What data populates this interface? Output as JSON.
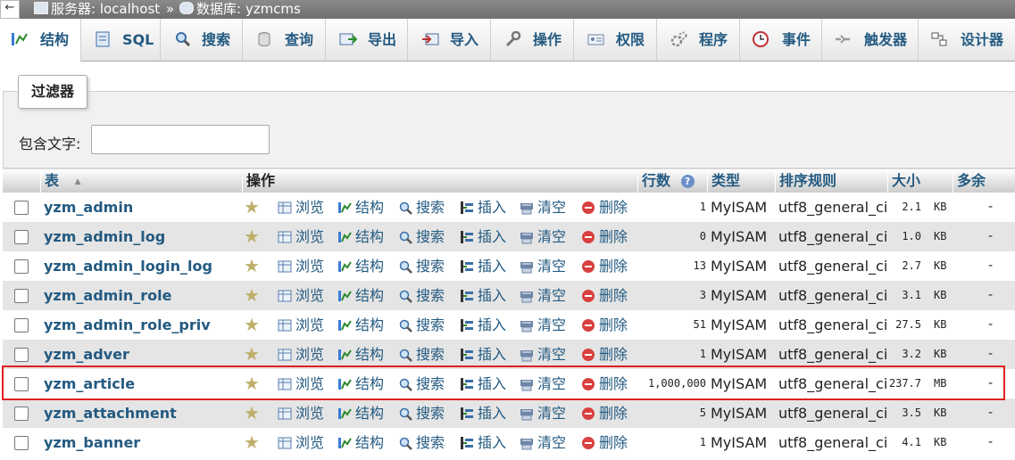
{
  "breadcrumb": {
    "back_glyph": "←",
    "server": "服务器: localhost",
    "sep": "»",
    "database": "数据库: yzmcms"
  },
  "tabs": [
    {
      "label": "结构",
      "icon": "structure-icon",
      "active": true
    },
    {
      "label": "SQL",
      "icon": "sql-icon"
    },
    {
      "label": "搜索",
      "icon": "search-icon"
    },
    {
      "label": "查询",
      "icon": "query-icon"
    },
    {
      "label": "导出",
      "icon": "export-icon"
    },
    {
      "label": "导入",
      "icon": "import-icon"
    },
    {
      "label": "操作",
      "icon": "wrench-icon"
    },
    {
      "label": "权限",
      "icon": "privileges-icon"
    },
    {
      "label": "程序",
      "icon": "routines-icon"
    },
    {
      "label": "事件",
      "icon": "events-icon"
    },
    {
      "label": "触发器",
      "icon": "triggers-icon"
    },
    {
      "label": "设计器",
      "icon": "designer-icon"
    }
  ],
  "filter": {
    "legend": "过滤器",
    "label": "包含文字:",
    "value": ""
  },
  "columns": {
    "table": "表",
    "sort_glyph": "▲",
    "action": "操作",
    "rows": "行数",
    "type": "类型",
    "collation": "排序规则",
    "size": "大小",
    "overhead": "多余"
  },
  "actions": [
    "浏览",
    "结构",
    "搜索",
    "插入",
    "清空",
    "删除"
  ],
  "rows": [
    {
      "name": "yzm_admin",
      "rows": "1",
      "type": "MyISAM",
      "collation": "utf8_general_ci",
      "size": "2.1",
      "unit": "KB",
      "overhead": "-"
    },
    {
      "name": "yzm_admin_log",
      "rows": "0",
      "type": "MyISAM",
      "collation": "utf8_general_ci",
      "size": "1.0",
      "unit": "KB",
      "overhead": "-"
    },
    {
      "name": "yzm_admin_login_log",
      "rows": "13",
      "type": "MyISAM",
      "collation": "utf8_general_ci",
      "size": "2.7",
      "unit": "KB",
      "overhead": "-"
    },
    {
      "name": "yzm_admin_role",
      "rows": "3",
      "type": "MyISAM",
      "collation": "utf8_general_ci",
      "size": "3.1",
      "unit": "KB",
      "overhead": "-"
    },
    {
      "name": "yzm_admin_role_priv",
      "rows": "51",
      "type": "MyISAM",
      "collation": "utf8_general_ci",
      "size": "27.5",
      "unit": "KB",
      "overhead": "-"
    },
    {
      "name": "yzm_adver",
      "rows": "1",
      "type": "MyISAM",
      "collation": "utf8_general_ci",
      "size": "3.2",
      "unit": "KB",
      "overhead": "-"
    },
    {
      "name": "yzm_article",
      "rows": "1,000,000",
      "type": "MyISAM",
      "collation": "utf8_general_ci",
      "size": "237.7",
      "unit": "MB",
      "overhead": "-"
    },
    {
      "name": "yzm_attachment",
      "rows": "5",
      "type": "MyISAM",
      "collation": "utf8_general_ci",
      "size": "3.5",
      "unit": "KB",
      "overhead": "-"
    },
    {
      "name": "yzm_banner",
      "rows": "1",
      "type": "MyISAM",
      "collation": "utf8_general_ci",
      "size": "4.1",
      "unit": "KB",
      "overhead": "-"
    }
  ],
  "colors": {
    "link": "#235a81",
    "highlight": "#e02020"
  }
}
